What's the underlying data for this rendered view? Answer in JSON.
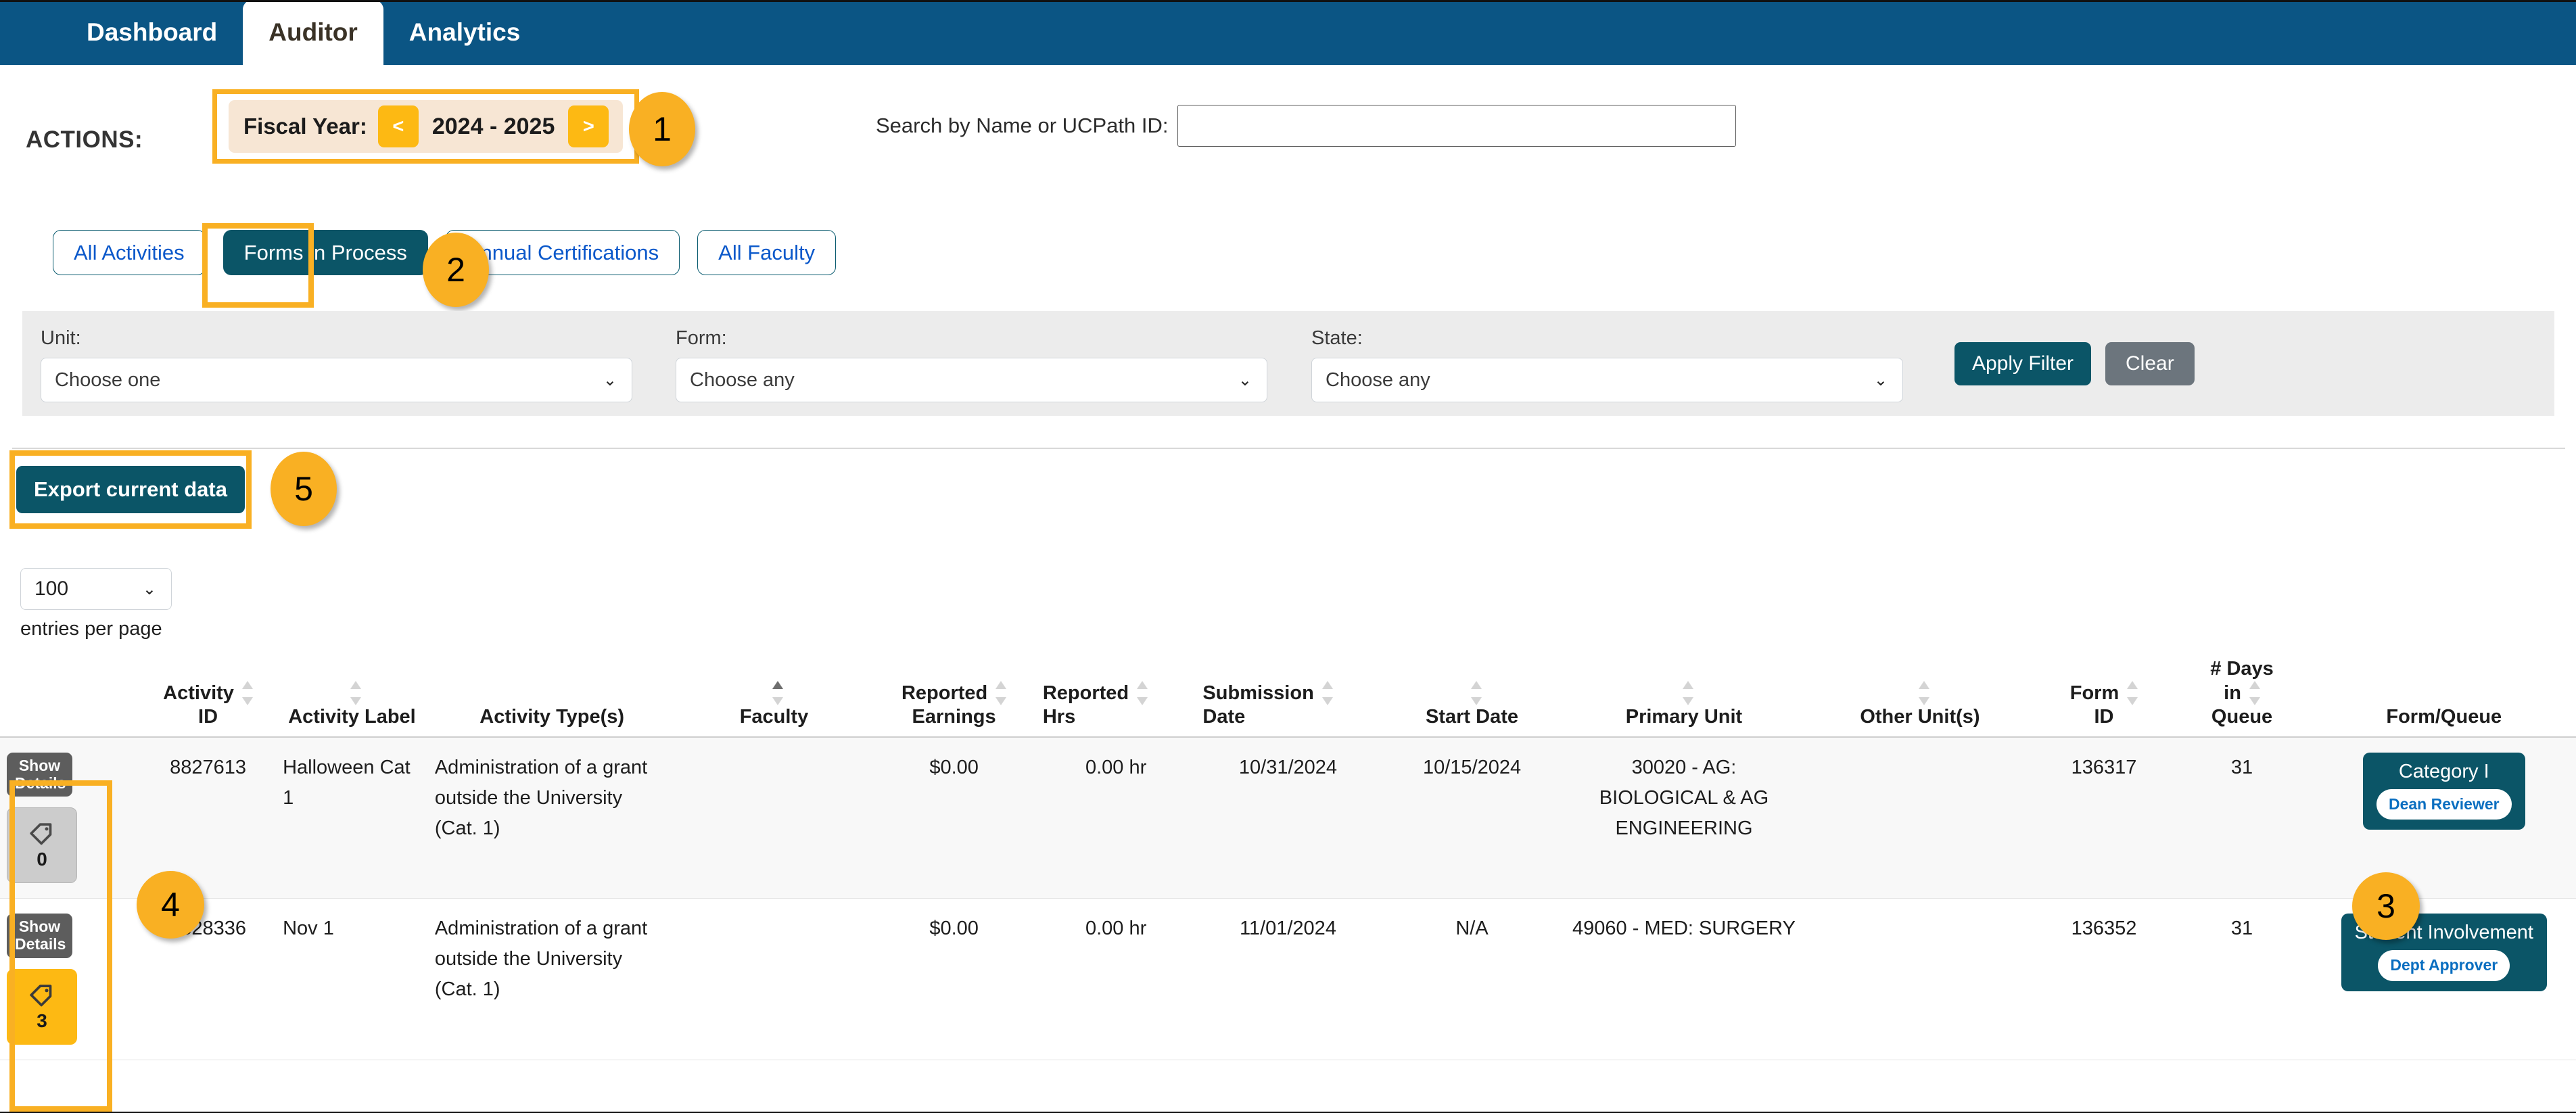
{
  "nav": {
    "tabs": [
      {
        "label": "Dashboard",
        "active": false
      },
      {
        "label": "Auditor",
        "active": true
      },
      {
        "label": "Analytics",
        "active": false
      }
    ]
  },
  "actions": {
    "label": "ACTIONS:",
    "fiscal_year": {
      "label": "Fiscal Year:",
      "prev": "<",
      "value": "2024 - 2025",
      "next": ">"
    }
  },
  "search": {
    "label": "Search by Name or UCPath ID:",
    "value": "",
    "placeholder": ""
  },
  "view_tabs": [
    {
      "label": "All Activities",
      "active": false
    },
    {
      "label": "Forms in Process",
      "active": true
    },
    {
      "label": "Annual Certifications",
      "active": false
    },
    {
      "label": "All Faculty",
      "active": false
    }
  ],
  "filters": {
    "unit": {
      "label": "Unit:",
      "value": "Choose one"
    },
    "form": {
      "label": "Form:",
      "value": "Choose any"
    },
    "state": {
      "label": "State:",
      "value": "Choose any"
    },
    "apply_label": "Apply Filter",
    "clear_label": "Clear"
  },
  "export": {
    "label": "Export current data"
  },
  "pagination": {
    "entries_value": "100",
    "entries_label": "entries per page"
  },
  "table": {
    "columns": [
      {
        "label": "Activity ID",
        "sort": "none"
      },
      {
        "label": "Activity Label",
        "sort": "none"
      },
      {
        "label": "Activity Type(s)",
        "sort": "none"
      },
      {
        "label": "Faculty",
        "sort": "asc"
      },
      {
        "label": "Reported Earnings",
        "sort": "none"
      },
      {
        "label": "Reported Hrs",
        "sort": "none"
      },
      {
        "label": "Submission Date",
        "sort": "none"
      },
      {
        "label": "Start Date",
        "sort": "none"
      },
      {
        "label": "Primary Unit",
        "sort": "none"
      },
      {
        "label": "Other Unit(s)",
        "sort": "none"
      },
      {
        "label": "Form ID",
        "sort": "none"
      },
      {
        "label": "# Days in Queue",
        "sort": "none"
      },
      {
        "label": "Form/Queue",
        "sort": "none"
      }
    ],
    "show_details_label": "Show Details",
    "rows": [
      {
        "tag_count": "0",
        "tag_style": "grey",
        "activity_id": "8827613",
        "activity_label": "Halloween Cat 1",
        "activity_type": "Administration of a grant outside the University (Cat. 1)",
        "faculty": "",
        "reported_earnings": "$0.00",
        "reported_hrs": "0.00 hr",
        "submission_date": "10/31/2024",
        "start_date": "10/15/2024",
        "primary_unit": "30020 - AG: BIOLOGICAL & AG ENGINEERING",
        "other_units": "",
        "form_id": "136317",
        "days_in_queue": "31",
        "queue_title": "Category I",
        "queue_role": "Dean Reviewer"
      },
      {
        "tag_count": "3",
        "tag_style": "gold",
        "activity_id": "8828336",
        "activity_label": "Nov 1",
        "activity_type": "Administration of a grant outside the University (Cat. 1)",
        "faculty": "",
        "reported_earnings": "$0.00",
        "reported_hrs": "0.00 hr",
        "submission_date": "11/01/2024",
        "start_date": "N/A",
        "primary_unit": "49060 - MED: SURGERY",
        "other_units": "",
        "form_id": "136352",
        "days_in_queue": "31",
        "queue_title": "Student Involvement",
        "queue_role": "Dept Approver"
      }
    ]
  },
  "callouts": [
    {
      "number": "1"
    },
    {
      "number": "2"
    },
    {
      "number": "3"
    },
    {
      "number": "4"
    },
    {
      "number": "5"
    }
  ],
  "colors": {
    "nav_blue": "#0b5584",
    "teal": "#0b5567",
    "gold": "#f9b023",
    "gold_btn": "#fdb913",
    "link_blue": "#0a58ca"
  }
}
